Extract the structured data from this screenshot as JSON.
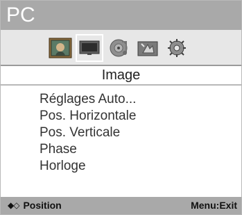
{
  "header": {
    "title": "PC"
  },
  "icons": [
    {
      "name": "picture-icon",
      "selected": false
    },
    {
      "name": "screen-icon",
      "selected": true
    },
    {
      "name": "audio-icon",
      "selected": false
    },
    {
      "name": "settings-icon",
      "selected": false
    },
    {
      "name": "gear-icon",
      "selected": false
    }
  ],
  "section": {
    "title": "Image"
  },
  "menu": {
    "items": [
      "Réglages Auto...",
      "Pos. Horizontale",
      "Pos. Verticale",
      "Phase",
      "Horloge"
    ]
  },
  "footer": {
    "nav_icon": "◆◇",
    "position_label": "Position",
    "exit_label": "Menu:Exit"
  }
}
